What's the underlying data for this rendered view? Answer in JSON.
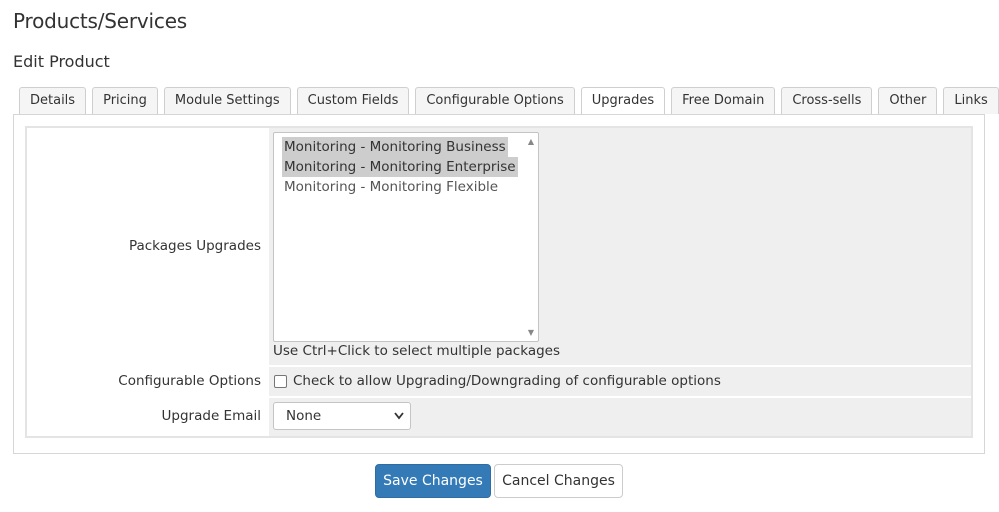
{
  "header": {
    "title": "Products/Services",
    "subtitle": "Edit Product"
  },
  "tabs": [
    {
      "label": "Details"
    },
    {
      "label": "Pricing"
    },
    {
      "label": "Module Settings"
    },
    {
      "label": "Custom Fields"
    },
    {
      "label": "Configurable Options"
    },
    {
      "label": "Upgrades",
      "active": true
    },
    {
      "label": "Free Domain"
    },
    {
      "label": "Cross-sells"
    },
    {
      "label": "Other"
    },
    {
      "label": "Links"
    }
  ],
  "form": {
    "packages_upgrades": {
      "label": "Packages Upgrades",
      "options": [
        {
          "label": "Monitoring - Monitoring Business",
          "selected": true
        },
        {
          "label": "Monitoring - Monitoring Enterprise",
          "selected": true
        },
        {
          "label": "Monitoring - Monitoring Flexible",
          "selected": false
        }
      ],
      "help": "Use Ctrl+Click to select multiple packages"
    },
    "configurable_options": {
      "label": "Configurable Options",
      "checkbox_label": "Check to allow Upgrading/Downgrading of configurable options",
      "checked": false
    },
    "upgrade_email": {
      "label": "Upgrade Email",
      "value": "None"
    }
  },
  "buttons": {
    "save": "Save Changes",
    "cancel": "Cancel Changes"
  },
  "colors": {
    "primary": "#337ab7",
    "field_background": "#efefef",
    "selected_option": "#cdcdcd"
  },
  "icons": {
    "select_arrow": "chevron-down-icon",
    "scroll_up": "scroll-up-arrow-icon",
    "scroll_down": "scroll-down-arrow-icon"
  }
}
